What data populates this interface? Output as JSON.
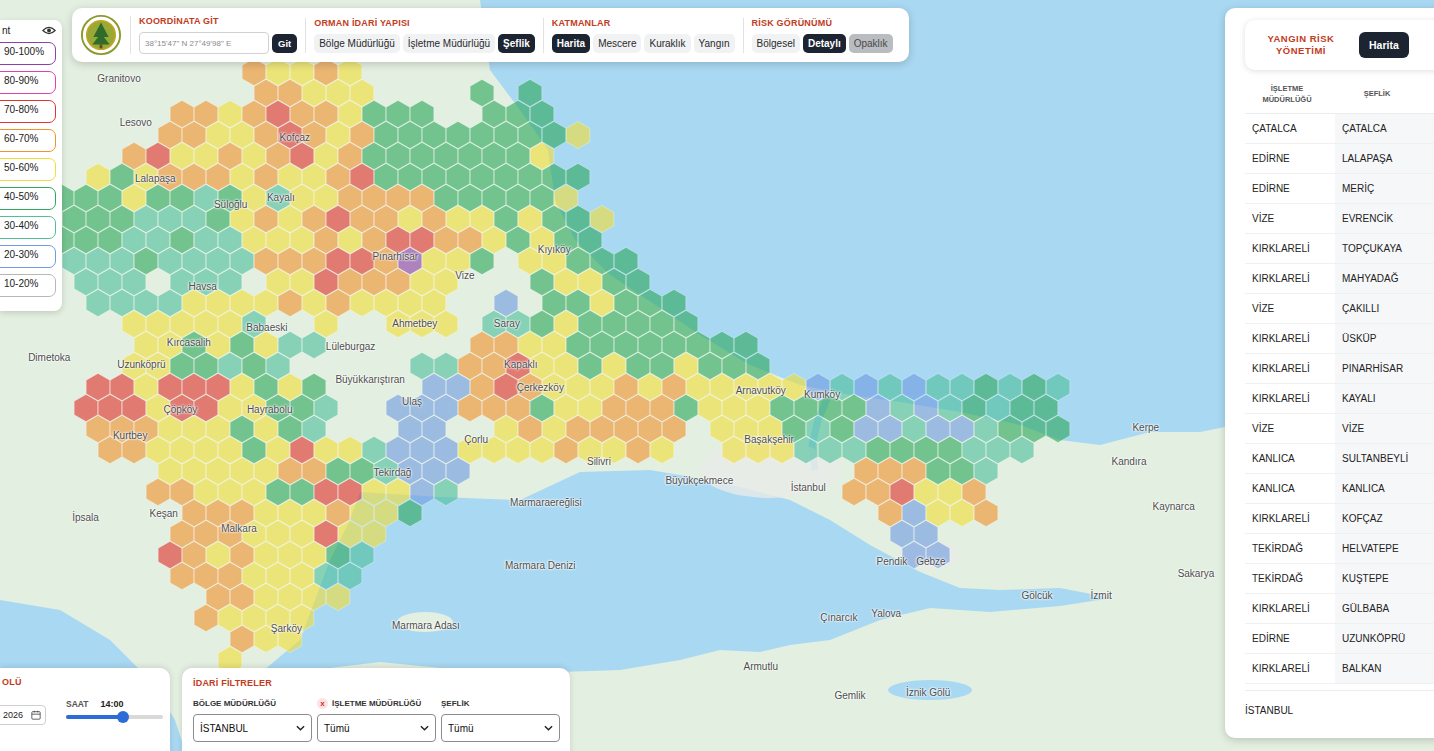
{
  "toolbar": {
    "coordinate": {
      "label": "KOORDİNATA GİT",
      "placeholder": "38°15'47\" N 27°49'98\" E",
      "button": "Git"
    },
    "sections": [
      {
        "label": "ORMAN İDARİ YAPISI",
        "items": [
          {
            "label": "Bölge Müdürlüğü",
            "kind": "option",
            "selected": false
          },
          {
            "label": "İşletme Müdürlüğü",
            "kind": "option",
            "selected": false
          },
          {
            "label": "Şeflik",
            "kind": "option",
            "selected": true
          }
        ]
      },
      {
        "label": "KATMANLAR",
        "items": [
          {
            "label": "Harita",
            "kind": "option",
            "selected": true
          },
          {
            "label": "Mescere",
            "kind": "option",
            "selected": false
          },
          {
            "label": "Kuraklık",
            "kind": "option",
            "selected": false
          },
          {
            "label": "Yangın",
            "kind": "option",
            "selected": false
          }
        ]
      },
      {
        "label": "RİSK GÖRÜNÜMÜ",
        "items": [
          {
            "label": "Bölgesel",
            "kind": "option",
            "selected": false
          },
          {
            "label": "Detaylı",
            "kind": "option",
            "selected": true
          },
          {
            "label": "Opaklık",
            "kind": "toggle",
            "selected": false,
            "on": true
          }
        ]
      }
    ]
  },
  "legend": {
    "title": "nt",
    "items": [
      {
        "label": "90-100%",
        "code": "p",
        "color": "#8e3fa8"
      },
      {
        "label": "80-90%",
        "code": "m",
        "color": "#e03fae"
      },
      {
        "label": "70-80%",
        "code": "r",
        "color": "#e0342f"
      },
      {
        "label": "60-70%",
        "code": "o",
        "color": "#f0922e"
      },
      {
        "label": "50-60%",
        "code": "y",
        "color": "#f0dd3a"
      },
      {
        "label": "40-50%",
        "code": "g",
        "color": "#2fa85e"
      },
      {
        "label": "30-40%",
        "code": "t",
        "color": "#4fbf9c"
      },
      {
        "label": "20-30%",
        "code": "b",
        "color": "#6f9be0"
      },
      {
        "label": "10-20%",
        "code": "w",
        "color": "#b8b8b8"
      }
    ]
  },
  "risk_grid": {
    "rows": [
      "........oyyoy",
      "........ooyyy....g.g",
      ".....ooyorooyggg..ggg",
      "....ooyyoroyoggggggggy",
      "...oryyoyoryogggggggy",
      ".ygyoooyoyyorggggggggg",
      "gggyggtgytyyoooogggggy",
      "gggtttgyoyorooyoyygyggy",
      "gggttgttyyyoyorrooygygg",
      "tttgttttooorropyyg.yyggg",
      ".ttt.ttt.yyroooyy...gyygg",
      ".ttttyyyyoyoyyyy..b.ggyggg",
      "...yyyyyt..y..yyy.ttgyggggg",
      "...yygygytt......ooyygggggggg",
      "...yyggtgt.....ttooryygyggyggg",
      ".rryrrrygyg....bboroyyyoyoyyyyybtbtbttgtgt",
      ".rrryrryyggt..bbbooogyyooogyyyggggbtbtgtgg",
      ".oooyyygygt...bb..yoyooooo.yyygtgbbtbbtggg",
      "..ooyyyygyryytbbbyyyyoyyoy..yyytttggggttt",
      "....yyyyyooggtbbb................oooggt",
      "....ooyyyggrryybt................ooryyo",
      ".....oooyyyoyyg...................obyyo",
      ".....oooyyyryy.....................bb",
      "....royoyyygt......................bb",
      ".....oooyyytt",
      "......ooyyyy",
      "......oyyyy",
      ".......oyy",
      ".......y"
    ]
  },
  "map_labels": [
    {
      "name": "Granitovo",
      "lon": 26.54,
      "lat": 42.11
    },
    {
      "name": "Lesovo",
      "lon": 26.6,
      "lat": 41.99
    },
    {
      "name": "Lalapaşa",
      "lon": 26.67,
      "lat": 41.84
    },
    {
      "name": "Süloğlu",
      "lon": 26.94,
      "lat": 41.77
    },
    {
      "name": "Kofçaz",
      "lon": 27.17,
      "lat": 41.95
    },
    {
      "name": "Kayalı",
      "lon": 27.12,
      "lat": 41.79
    },
    {
      "name": "Pınarhisar",
      "lon": 27.53,
      "lat": 41.63
    },
    {
      "name": "Vize",
      "lon": 27.78,
      "lat": 41.58
    },
    {
      "name": "Kıyıköy",
      "lon": 28.1,
      "lat": 41.65
    },
    {
      "name": "Saray",
      "lon": 27.93,
      "lat": 41.45
    },
    {
      "name": "Ahmetbey",
      "lon": 27.6,
      "lat": 41.45
    },
    {
      "name": "Lüleburgaz",
      "lon": 27.37,
      "lat": 41.39
    },
    {
      "name": "Babaeski",
      "lon": 27.07,
      "lat": 41.44
    },
    {
      "name": "Havsa",
      "lon": 26.84,
      "lat": 41.55
    },
    {
      "name": "Büyükkarıştıran",
      "lon": 27.44,
      "lat": 41.3
    },
    {
      "name": "Çerkezköy",
      "lon": 28.05,
      "lat": 41.28
    },
    {
      "name": "Kapaklı",
      "lon": 27.98,
      "lat": 41.34
    },
    {
      "name": "Çorlu",
      "lon": 27.82,
      "lat": 41.14
    },
    {
      "name": "Tekirdağ",
      "lon": 27.52,
      "lat": 41.05
    },
    {
      "name": "Marmaraereğlisi",
      "lon": 28.07,
      "lat": 40.97
    },
    {
      "name": "Silivri",
      "lon": 28.26,
      "lat": 41.08
    },
    {
      "name": "Büyükçekmece",
      "lon": 28.62,
      "lat": 41.03
    },
    {
      "name": "Arnavutköy",
      "lon": 28.84,
      "lat": 41.27
    },
    {
      "name": "Başakşehir",
      "lon": 28.87,
      "lat": 41.14
    },
    {
      "name": "İstanbul",
      "lon": 29.01,
      "lat": 41.01
    },
    {
      "name": "Kumköy",
      "lon": 29.06,
      "lat": 41.26
    },
    {
      "name": "Pendik",
      "lon": 29.31,
      "lat": 40.81
    },
    {
      "name": "Gebze",
      "lon": 29.45,
      "lat": 40.81
    },
    {
      "name": "Kerpe",
      "lon": 30.22,
      "lat": 41.17
    },
    {
      "name": "Kandıra",
      "lon": 30.16,
      "lat": 41.08
    },
    {
      "name": "Kaynarca",
      "lon": 30.32,
      "lat": 40.96
    },
    {
      "name": "Gölcük",
      "lon": 29.83,
      "lat": 40.72
    },
    {
      "name": "İzmit",
      "lon": 30.06,
      "lat": 40.72
    },
    {
      "name": "Sakarya",
      "lon": 30.4,
      "lat": 40.78
    },
    {
      "name": "Yalova",
      "lon": 29.29,
      "lat": 40.67
    },
    {
      "name": "Çınarcık",
      "lon": 29.12,
      "lat": 40.66
    },
    {
      "name": "Armutlu",
      "lon": 28.84,
      "lat": 40.53
    },
    {
      "name": "Gemlik",
      "lon": 29.16,
      "lat": 40.45
    },
    {
      "name": "İznik Gölü",
      "lon": 29.44,
      "lat": 40.46
    },
    {
      "name": "Marmara Denizi",
      "lon": 28.05,
      "lat": 40.8
    },
    {
      "name": "Marmara Adası",
      "lon": 27.64,
      "lat": 40.64
    },
    {
      "name": "Uzunköprü",
      "lon": 26.62,
      "lat": 41.34
    },
    {
      "name": "Çöpköy",
      "lon": 26.76,
      "lat": 41.22
    },
    {
      "name": "Kurtbey",
      "lon": 26.58,
      "lat": 41.15
    },
    {
      "name": "Hayrabolu",
      "lon": 27.08,
      "lat": 41.22
    },
    {
      "name": "Ulaş",
      "lon": 27.59,
      "lat": 41.24
    },
    {
      "name": "Malkara",
      "lon": 26.97,
      "lat": 40.9
    },
    {
      "name": "Keşan",
      "lon": 26.7,
      "lat": 40.94
    },
    {
      "name": "İpsala",
      "lon": 26.42,
      "lat": 40.93
    },
    {
      "name": "Şarköy",
      "lon": 27.14,
      "lat": 40.63
    },
    {
      "name": "Dimetoka",
      "lon": 26.29,
      "lat": 41.36
    },
    {
      "name": "Kırcasalih",
      "lon": 26.79,
      "lat": 41.4
    }
  ],
  "time_panel": {
    "title": "OLÜ",
    "date": "2026",
    "time_label": "SAAT",
    "time": "14:00",
    "slider": {
      "level": 0.59
    }
  },
  "filters": {
    "title": "İDARİ FİLTRELER",
    "clear_icon": "x",
    "fields": [
      {
        "label": "BÖLGE MÜDÜRLÜĞÜ",
        "value": "İSTANBUL",
        "clearable": false
      },
      {
        "label": "İŞLETME MÜDÜRLÜĞÜ",
        "value": "Tümü",
        "clearable": true
      },
      {
        "label": "ŞEFLİK",
        "value": "Tümü",
        "clearable": false
      }
    ]
  },
  "side_panel": {
    "title": "YANGIN RİSK YÖNETİMİ",
    "view_button": {
      "label": "Harita",
      "selected": true
    },
    "columns": [
      "İŞLETME MÜDÜRLÜĞÜ",
      "ŞEFLİK"
    ],
    "rows": [
      {
        "unit": "ÇATALCA",
        "chief": "ÇATALCA"
      },
      {
        "unit": "EDİRNE",
        "chief": "LALAPAŞA"
      },
      {
        "unit": "EDİRNE",
        "chief": "MERİÇ"
      },
      {
        "unit": "VİZE",
        "chief": "EVRENCİK"
      },
      {
        "unit": "KIRKLARELİ",
        "chief": "TOPÇUKAYA"
      },
      {
        "unit": "KIRKLARELİ",
        "chief": "MAHYADAĞ"
      },
      {
        "unit": "VİZE",
        "chief": "ÇAKILLI"
      },
      {
        "unit": "KIRKLARELİ",
        "chief": "ÜSKÜP"
      },
      {
        "unit": "KIRKLARELİ",
        "chief": "PINARHİSAR"
      },
      {
        "unit": "KIRKLARELİ",
        "chief": "KAYALI"
      },
      {
        "unit": "VİZE",
        "chief": "VİZE"
      },
      {
        "unit": "KANLICA",
        "chief": "SULTANBEYLİ"
      },
      {
        "unit": "KANLICA",
        "chief": "KANLICA"
      },
      {
        "unit": "KIRKLARELİ",
        "chief": "KOFÇAZ"
      },
      {
        "unit": "TEKİRDAĞ",
        "chief": "HELVATEPE"
      },
      {
        "unit": "TEKİRDAĞ",
        "chief": "KUŞTEPE"
      },
      {
        "unit": "KIRKLARELİ",
        "chief": "GÜLBABA"
      },
      {
        "unit": "EDİRNE",
        "chief": "UZUNKÖPRÜ"
      },
      {
        "unit": "KIRKLARELİ",
        "chief": "BALKAN"
      }
    ],
    "footer": "İSTANBUL"
  }
}
